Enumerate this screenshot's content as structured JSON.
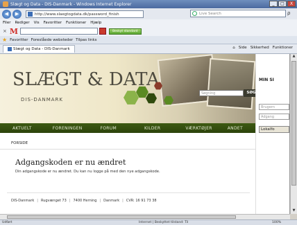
{
  "window": {
    "title": "Slægt og Data - DIS-Danmark - Windows Internet Explorer",
    "minimize": "_",
    "maximize": "□",
    "close": "X"
  },
  "address_bar": {
    "back": "◀",
    "forward": "▶",
    "url": "http://www.slaegtogdata.dk/password_finish",
    "search_placeholder": "Live Search",
    "search_go": "ρ"
  },
  "menu": {
    "items": [
      "Filer",
      "Rediger",
      "Vis",
      "Favoritter",
      "Funktioner",
      "Hjælp"
    ]
  },
  "toolbar": {
    "close_symbol": "×",
    "logo_letter": "M",
    "green_button": "Beskyt standard"
  },
  "favorites_bar": {
    "label": "Favoritter",
    "suggested": "Foreslåede websteder",
    "more": "Tilpas links"
  },
  "tab": {
    "label": "Slægt og Data - DIS-Danmark"
  },
  "command_bar": {
    "items": [
      "Side",
      "Sikkerhed",
      "Funktioner"
    ]
  },
  "site": {
    "brand_main": "SLÆGT & DATA",
    "brand_sub": "DIS-DANMARK",
    "search_placeholder": "Søgning",
    "search_button": "SØG",
    "nav": [
      "AKTUELT",
      "FORENINGEN",
      "FORUM",
      "KILDER",
      "VÆRKTØJER",
      "ANDET"
    ],
    "breadcrumb": "FORSIDE",
    "heading": "Adgangskoden er nu ændret",
    "message": "Din adgangskode er nu ændret. Du kan nu logge på med den nye adgangskode.",
    "footer": [
      "DIS-Danmark",
      "Rugvænget 73",
      "7400 Herning",
      "Danmark",
      "CVR: 16 91 73 38"
    ],
    "footer_sep": "|"
  },
  "sidebar": {
    "title": "MIN SI",
    "user_placeholder": "Brugern",
    "password_placeholder": "Adgang",
    "login_button": "Lokalfo"
  },
  "statusbar": {
    "left": "Udført",
    "zone": "Internet | Beskyttet tilstand: Til",
    "zoom": "100%"
  },
  "colors": {
    "nav_bg": "#2f4a0d",
    "hex_green": "#5a8a22",
    "hex_dark": "#2f4a0d",
    "hex_light": "#8bb34a",
    "hex_red": "#8a3b2a"
  }
}
